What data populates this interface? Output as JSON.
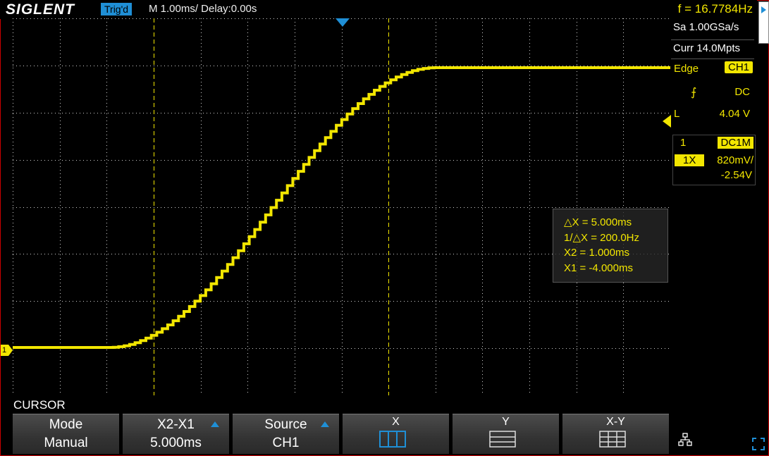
{
  "header": {
    "brand": "SIGLENT",
    "trigger_status": "Trig'd",
    "timebase": "M 1.00ms/ Delay:0.00s",
    "frequency": "f = 16.7784Hz"
  },
  "acquisition": {
    "sample_rate": "Sa 1.00GSa/s",
    "memory": "Curr 14.0Mpts"
  },
  "trigger": {
    "type": "Edge",
    "source": "CH1",
    "coupling": "DC",
    "level_label": "L",
    "level_value": "4.04 V"
  },
  "channel": {
    "number": "1",
    "coupling": "DC1M",
    "probe": "1X",
    "scale": "820mV/",
    "offset": "-2.54V",
    "marker_label": "1"
  },
  "cursor_readout": {
    "delta_x": "△X = 5.000ms",
    "inv_delta_x": "1/△X = 200.0Hz",
    "x2": "X2 = 1.000ms",
    "x1": "X1 = -4.000ms"
  },
  "menu": {
    "title": "CURSOR",
    "buttons": [
      {
        "top": "Mode",
        "bottom": "Manual"
      },
      {
        "top": "X2-X1",
        "bottom": "5.000ms"
      },
      {
        "top": "Source",
        "bottom": "CH1"
      },
      {
        "top": "X",
        "bottom": ""
      },
      {
        "top": "Y",
        "bottom": ""
      },
      {
        "top": "X-Y",
        "bottom": ""
      }
    ]
  },
  "colors": {
    "trace": "#f2e600",
    "accent": "#1f8fd6",
    "background": "#000000"
  },
  "icons": {
    "network": "network-icon",
    "expand": "expand-icon"
  }
}
